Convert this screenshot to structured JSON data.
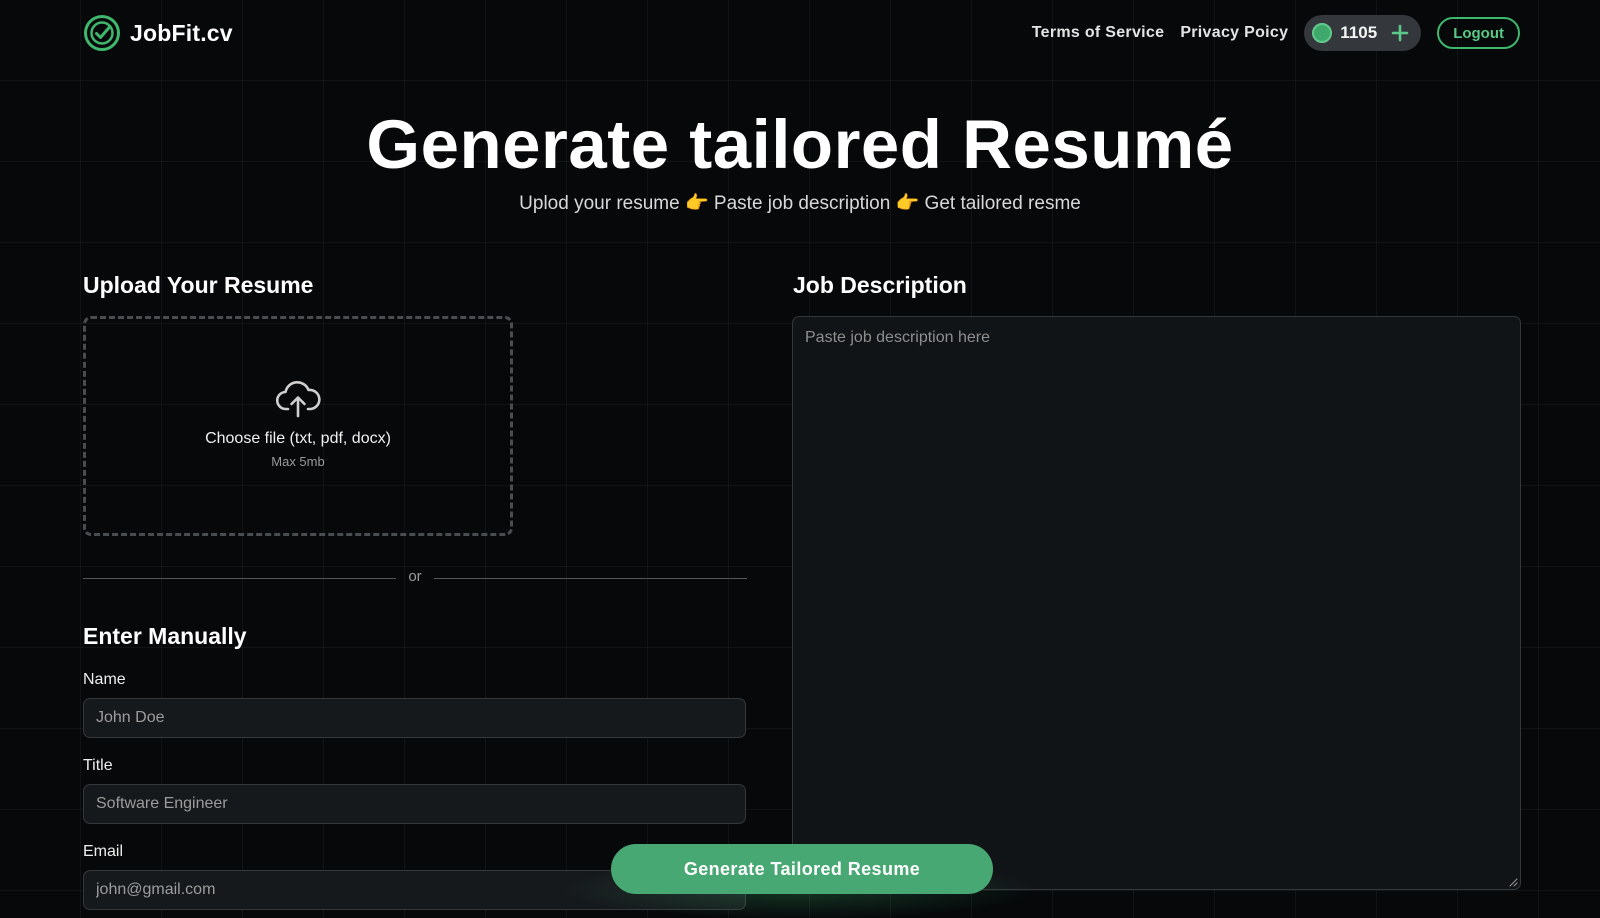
{
  "header": {
    "brand_name": "JobFit.cv",
    "nav": [
      {
        "label": "Terms of Service"
      },
      {
        "label": "Privacy Poicy"
      }
    ],
    "credits": "1105",
    "logout_label": "Logout"
  },
  "hero": {
    "title": "Generate tailored Resumé",
    "sub_step1": "Uplod your resume",
    "sub_step2": "Paste job description",
    "sub_step3": "Get tailored resme",
    "hand_glyph": "👉"
  },
  "upload": {
    "section_title": "Upload Your Resume",
    "choose_label": "Choose file (txt, pdf, docx)",
    "max_size": "Max 5mb",
    "divider_text": "or"
  },
  "manual": {
    "section_title": "Enter Manually",
    "fields": [
      {
        "label": "Name",
        "placeholder": "John Doe",
        "value": ""
      },
      {
        "label": "Title",
        "placeholder": "Software Engineer",
        "value": ""
      },
      {
        "label": "Email",
        "placeholder": "john@gmail.com",
        "value": ""
      }
    ]
  },
  "job": {
    "section_title": "Job Description",
    "placeholder": "Paste job description here",
    "value": ""
  },
  "cta": {
    "label": "Generate Tailored Resume"
  },
  "colors": {
    "accent": "#48a873",
    "accent_border": "#3fb76d",
    "background": "#06080a",
    "input_bg": "#16191c"
  },
  "icons": {
    "logo": "check-circle-icon",
    "credits": "coin-icon",
    "add": "plus-icon",
    "upload": "cloud-upload-icon",
    "pointer": "pointing-hand-icon"
  }
}
